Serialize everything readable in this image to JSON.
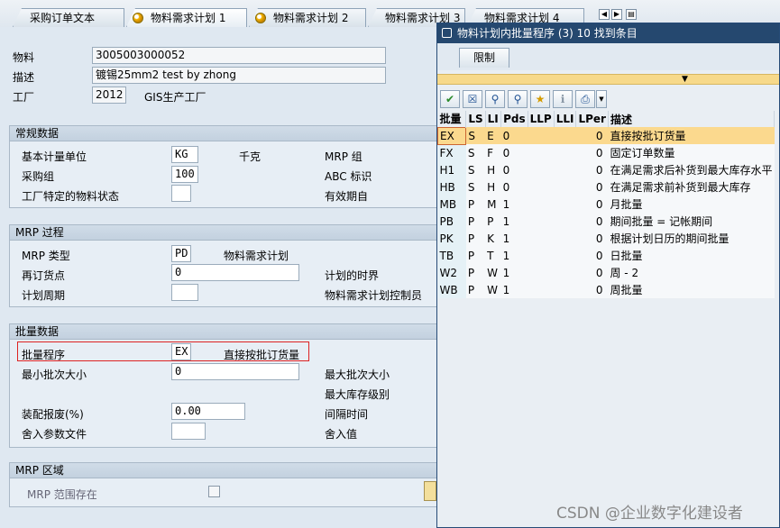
{
  "tabs": [
    {
      "label": "采购订单文本",
      "active": false
    },
    {
      "label": "物料需求计划 1",
      "active": true
    },
    {
      "label": "物料需求计划 2",
      "active": false
    },
    {
      "label": "物料需求计划 3",
      "active": false
    },
    {
      "label": "物料需求计划 4",
      "active": false
    }
  ],
  "header": {
    "material_label": "物料",
    "material_value": "3005003000052",
    "desc_label": "描述",
    "desc_value": "镀锡25mm2 test by zhong",
    "plant_label": "工厂",
    "plant_value": "2012",
    "plant_name": "GIS生产工厂"
  },
  "general": {
    "title": "常规数据",
    "base_uom_label": "基本计量单位",
    "base_uom_value": "KG",
    "base_uom_text": "千克",
    "mrp_group_label": "MRP 组",
    "purch_group_label": "采购组",
    "purch_group_value": "100",
    "abc_label": "ABC 标识",
    "plant_status_label": "工厂特定的物料状态",
    "valid_from_label": "有效期自"
  },
  "mrp_proc": {
    "title": "MRP 过程",
    "mrp_type_label": "MRP 类型",
    "mrp_type_value": "PD",
    "mrp_type_text": "物料需求计划",
    "reorder_label": "再订货点",
    "reorder_value": "0",
    "plan_time_label": "计划的时界",
    "plan_cycle_label": "计划周期",
    "controller_label": "物料需求计划控制员"
  },
  "lot": {
    "title": "批量数据",
    "lot_proc_label": "批量程序",
    "lot_proc_value": "EX",
    "lot_proc_text": "直接按批订货量",
    "min_lot_label": "最小批次大小",
    "min_lot_value": "0",
    "max_lot_label": "最大批次大小",
    "max_stock_label": "最大库存级别",
    "scrap_label": "装配报废(%)",
    "scrap_value": "0.00",
    "interval_label": "间隔时间",
    "rounding_profile_label": "舍入参数文件",
    "rounding_value_label": "舍入值"
  },
  "mrp_area": {
    "title": "MRP 区域",
    "exists_label": "MRP 范围存在"
  },
  "popup": {
    "title": "物料计划内批量程序 (3)   10 找到条目",
    "tab_label": "限制",
    "columns": [
      "批量",
      "LS",
      "LI",
      "Pds",
      "LLP",
      "LLI",
      "LPer",
      "描述"
    ],
    "rows": [
      {
        "lot": "EX",
        "ls": "S",
        "li": "E",
        "pds": "0",
        "llp": "",
        "lli": "",
        "lper": "0",
        "desc": "直接按批订货量",
        "selected": true
      },
      {
        "lot": "FX",
        "ls": "S",
        "li": "F",
        "pds": "0",
        "llp": "",
        "lli": "",
        "lper": "0",
        "desc": "固定订单数量",
        "selected": false
      },
      {
        "lot": "H1",
        "ls": "S",
        "li": "H",
        "pds": "0",
        "llp": "",
        "lli": "",
        "lper": "0",
        "desc": "在满足需求后补货到最大库存水平",
        "selected": false
      },
      {
        "lot": "HB",
        "ls": "S",
        "li": "H",
        "pds": "0",
        "llp": "",
        "lli": "",
        "lper": "0",
        "desc": "在满足需求前补货到最大库存",
        "selected": false
      },
      {
        "lot": "MB",
        "ls": "P",
        "li": "M",
        "pds": "1",
        "llp": "",
        "lli": "",
        "lper": "0",
        "desc": "月批量",
        "selected": false
      },
      {
        "lot": "PB",
        "ls": "P",
        "li": "P",
        "pds": "1",
        "llp": "",
        "lli": "",
        "lper": "0",
        "desc": "期间批量 = 记帐期间",
        "selected": false
      },
      {
        "lot": "PK",
        "ls": "P",
        "li": "K",
        "pds": "1",
        "llp": "",
        "lli": "",
        "lper": "0",
        "desc": "根据计划日历的期间批量",
        "selected": false
      },
      {
        "lot": "TB",
        "ls": "P",
        "li": "T",
        "pds": "1",
        "llp": "",
        "lli": "",
        "lper": "0",
        "desc": "日批量",
        "selected": false
      },
      {
        "lot": "W2",
        "ls": "P",
        "li": "W",
        "pds": "1",
        "llp": "",
        "lli": "",
        "lper": "0",
        "desc": "周 - 2",
        "selected": false
      },
      {
        "lot": "WB",
        "ls": "P",
        "li": "W",
        "pds": "1",
        "llp": "",
        "lli": "",
        "lper": "0",
        "desc": "周批量",
        "selected": false
      }
    ]
  },
  "watermark": "CSDN @企业数字化建设者",
  "icons": {
    "tab": "tab-status-icon",
    "nav_prev": "nav-left-icon",
    "nav_next": "nav-right-icon",
    "nav_menu": "nav-menu-icon",
    "toolbar": [
      "check-icon",
      "cancel-icon",
      "find-icon",
      "find-next-icon",
      "favorite-icon",
      "info-icon",
      "print-icon"
    ]
  },
  "colors": {
    "title_bar": "#25486f",
    "selection": "#fbd98e",
    "highlight_border": "#dd2222",
    "key_column": "#e5f1f6"
  }
}
